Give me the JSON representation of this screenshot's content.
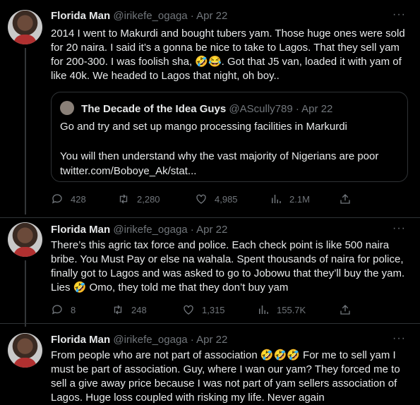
{
  "tweets": [
    {
      "name": "Florida Man",
      "meta": "@irikefe_ogaga · Apr 22",
      "body": "2014 I went to Makurdi and bought tubers yam. Those huge ones were sold for 20 naira. I said it’s a gonna be nice to take to Lagos. That they sell yam for 200-300. I was foolish sha, 🤣😂. Got that J5 van, loaded it with yam of like 40k. We headed to Lagos that night, oh boy..",
      "quote": {
        "name": "The Decade of the Idea Guys",
        "meta": "@AScully789 · Apr 22",
        "text1": "Go and try and set up mango processing facilities in Markurdi",
        "text2": "You will then understand why the vast majority of Nigerians are poor",
        "link": "twitter.com/Boboye_Ak/stat..."
      },
      "replies": "428",
      "retweets": "2,280",
      "likes": "4,985",
      "views": "2.1M"
    },
    {
      "name": "Florida Man",
      "meta": "@irikefe_ogaga · Apr 22",
      "body": "There’s this agric tax force and police. Each check point is like 500 naira bribe. You Must Pay or else na wahala. Spent thousands of naira for police, finally got to Lagos and was asked to go to Jobowu that they’ll buy the yam. Lies 🤣 Omo, they told me that they don’t buy yam",
      "replies": "8",
      "retweets": "248",
      "likes": "1,315",
      "views": "155.7K"
    },
    {
      "name": "Florida Man",
      "meta": "@irikefe_ogaga · Apr 22",
      "body": "From people who are not part of association 🤣🤣🤣 For me to sell yam I must be part of association. Guy, where I wan our yam? They forced me to sell a give away price because I was not part of yam sellers association of Lagos. Huge loss coupled with risking my life. Never again"
    }
  ],
  "more_label": "···",
  "icons": [
    "reply-icon",
    "retweet-icon",
    "like-icon",
    "views-icon",
    "share-icon"
  ],
  "colors": {
    "background": "#000000",
    "text": "#e7e9ea",
    "muted": "#71767b",
    "border": "#2f3336"
  }
}
